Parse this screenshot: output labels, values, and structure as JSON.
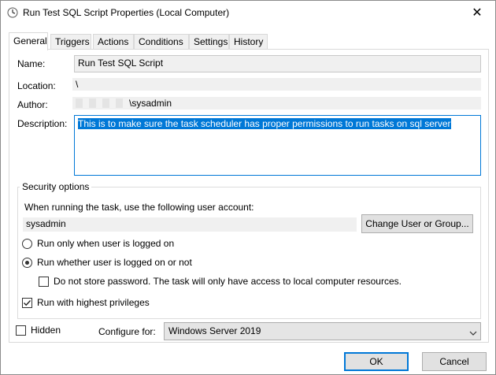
{
  "window": {
    "title": "Run Test SQL Script Properties (Local Computer)"
  },
  "tabs": [
    "General",
    "Triggers",
    "Actions",
    "Conditions",
    "Settings",
    "History"
  ],
  "general": {
    "name_label": "Name:",
    "name_value": "Run Test SQL Script",
    "location_label": "Location:",
    "location_value": "\\",
    "author_label": "Author:",
    "author_value": "\\sysadmin",
    "description_label": "Description:",
    "description_value": "This is to make sure the task scheduler has proper permissions to run tasks on sql server"
  },
  "security": {
    "title": "Security options",
    "account_prompt": "When running the task, use the following user account:",
    "account_value": "sysadmin",
    "change_button": "Change User or Group...",
    "radio_logged_on": "Run only when user is logged on",
    "radio_whether": "Run whether user is logged on or not",
    "radio_selected": "whether",
    "no_store_password": "Do not store password.  The task will only have access to local computer resources.",
    "no_store_password_checked": false,
    "highest_privileges": "Run with highest privileges",
    "highest_privileges_checked": true
  },
  "footer_options": {
    "hidden_label": "Hidden",
    "hidden_checked": false,
    "configure_label": "Configure for:",
    "configure_value": "Windows Server 2019"
  },
  "buttons": {
    "ok": "OK",
    "cancel": "Cancel"
  },
  "colors": {
    "accent": "#0078d7",
    "selection": "#0078d7"
  }
}
